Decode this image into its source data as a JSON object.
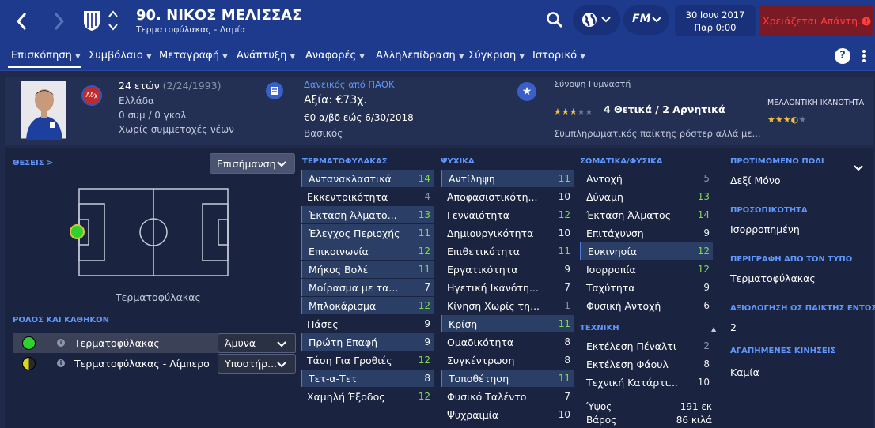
{
  "header": {
    "title": "90. ΝΙΚΟΣ ΜΕΛΙΣΣΑΣ",
    "subtitle": "Τερματοφύλακας - Λαμία",
    "date": "30 Ιουν 2017",
    "time": "Παρ 0:00",
    "alert": "Χρειάζεται Απάντη...",
    "fm_label": "FM"
  },
  "nav": [
    "Επισκόπηση",
    "Συμβόλαιο",
    "Μεταγραφή",
    "Ανάπτυξη",
    "Αναφορές",
    "Αλληλεπίδραση",
    "Σύγκριση",
    "Ιστορικό"
  ],
  "profile": {
    "age": "24 ετών",
    "dob": "(2/24/1993)",
    "nation": "Ελλάδα",
    "caps": "0 συμ / 0 γκολ",
    "youth": "Χωρίς συμμετοχές νέων",
    "badge": "Αδχ"
  },
  "contract": {
    "loan": "Δανεικός από ΠΑΟΚ",
    "value": "Αξία: €73χ.",
    "wage": "€0 α/βδ εώς 6/30/2018",
    "status": "Βασικός"
  },
  "coach": {
    "label": "Σύνοψη Γυμναστή",
    "summary": "4 Θετικά / 2 Αρνητικά",
    "desc": "Συμπληρωματικός παίκτης ρόστερ αλλά με...",
    "future_label": "ΜΕΛΛΟΝΤΙΚΗ ΙΚΑΝΟΤΗΤΑ",
    "current_stars": 3,
    "future_stars": 3.5
  },
  "positions": {
    "label": "ΘΕΣΕΙΣ >",
    "dropdown": "Επισήμανση",
    "caption": "Τερματοφύλακας"
  },
  "roles": {
    "label": "ΡΟΛΟΣ ΚΑΙ ΚΑΘΗΚΟΝ",
    "items": [
      {
        "name": "Τερματοφύλακας",
        "duty": "Άμυνα",
        "color": "#2fd12f"
      },
      {
        "name": "Τερματοφύλακας - Λίμπερο",
        "duty": "Υποστήρ...",
        "color": "#d8d820"
      }
    ]
  },
  "gk": {
    "label": "ΤΕΡΜΑΤΟΦΥΛΑΚΑΣ",
    "attrs": [
      [
        "Αντανακλαστικά",
        "14"
      ],
      [
        "Εκκεντρικότητα",
        "4"
      ],
      [
        "Έκταση Άλματο...",
        "13"
      ],
      [
        "Έλεγχος Περιοχής",
        "11"
      ],
      [
        "Επικοινωνία",
        "12"
      ],
      [
        "Μήκος Βολέ",
        "11"
      ],
      [
        "Μοίρασμα με τα...",
        "7"
      ],
      [
        "Μπλοκάρισμα",
        "12"
      ],
      [
        "Πάσες",
        "9"
      ],
      [
        "Πρώτη Επαφή",
        "9"
      ],
      [
        "Τάση Για Γροθιές",
        "12"
      ],
      [
        "Τετ-α-Τετ",
        "8"
      ],
      [
        "Χαμηλή Έξοδος",
        "12"
      ]
    ]
  },
  "mental": {
    "label": "ΨΥΧΙΚΑ",
    "attrs": [
      [
        "Αντίληψη",
        "11"
      ],
      [
        "Αποφασιστικότη...",
        "10"
      ],
      [
        "Γενναιότητα",
        "12"
      ],
      [
        "Δημιουργικότητα",
        "10"
      ],
      [
        "Επιθετικότητα",
        "11"
      ],
      [
        "Εργατικότητα",
        "9"
      ],
      [
        "Ηγετική Ικανότη...",
        "7"
      ],
      [
        "Κίνηση Χωρίς τη...",
        "1"
      ],
      [
        "Κρίση",
        "11"
      ],
      [
        "Ομαδικότητα",
        "8"
      ],
      [
        "Συγκέντρωση",
        "8"
      ],
      [
        "Τοποθέτηση",
        "11"
      ],
      [
        "Φυσικό Ταλέντο",
        "7"
      ],
      [
        "Ψυχραιμία",
        "10"
      ]
    ]
  },
  "physical": {
    "label": "ΣΩΜΑΤΙΚΑ/ΦΥΣΙΚΑ",
    "attrs": [
      [
        "Αντοχή",
        "5"
      ],
      [
        "Δύναμη",
        "13"
      ],
      [
        "Έκταση Άλματος",
        "14"
      ],
      [
        "Επιτάχυνση",
        "9"
      ],
      [
        "Ευκινησία",
        "12"
      ],
      [
        "Ισορροπία",
        "12"
      ],
      [
        "Ταχύτητα",
        "9"
      ],
      [
        "Φυσική Αντοχή",
        "6"
      ]
    ]
  },
  "technical": {
    "label": "ΤΕΧΝΙΚΗ",
    "attrs": [
      [
        "Εκτέλεση Πέναλτι",
        "2"
      ],
      [
        "Εκτέλεση Φάουλ",
        "8"
      ],
      [
        "Τεχνική Κατάρτι...",
        "10"
      ]
    ]
  },
  "body": {
    "height_label": "Ύψος",
    "height": "191 εκ",
    "weight_label": "Βάρος",
    "weight": "86 κιλά"
  },
  "side": {
    "foot_label": "ΠΡΟΤΙΜΩΜΕΝΟ ΠΟΔΙ",
    "foot": "Δεξί Μόνο",
    "personality_label": "ΠΡΟΣΩΠΙΚΟΤΗΤΑ",
    "personality": "Ισορροπημένη",
    "media_label": "ΠΕΡΙΓΡΑΦΗ ΑΠΟ ΤΟΝ ΤΥΠΟ",
    "media": "Τερματοφύλακας",
    "rating_label": "ΑΞΙΟΛΟΓΗΣΗ ΩΣ ΠΑΙΚΤΗΣ ΕΝΤΟΣ",
    "rating": "2",
    "moves_label": "ΑΓΑΠΗΜΕΝΕΣ ΚΙΝΗΣΕΙΣ",
    "moves": "Καμία"
  }
}
